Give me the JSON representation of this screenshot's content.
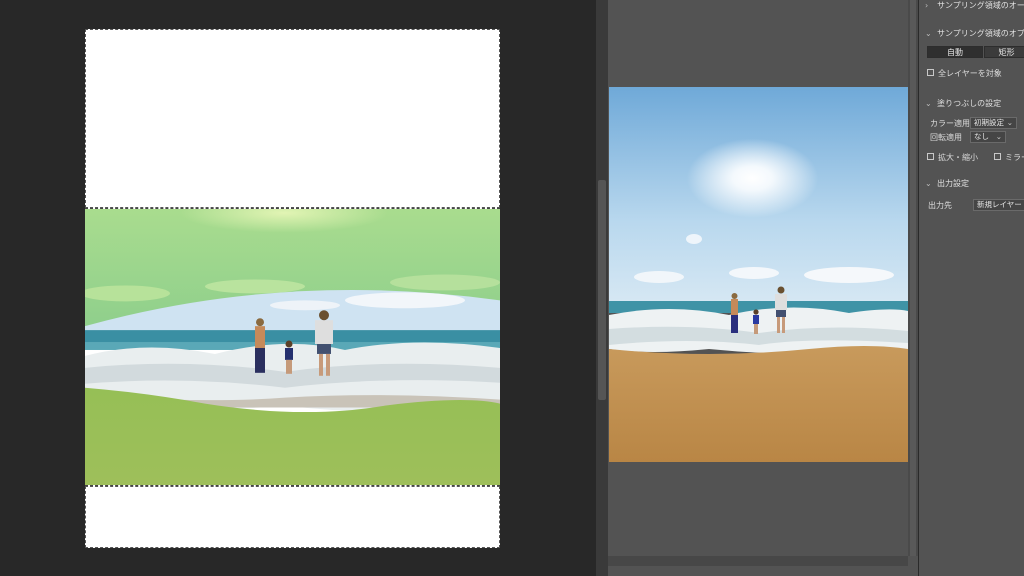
{
  "options": {
    "sampling_overlay": "サンプリング領域のオーバー",
    "sampling_options": "サンプリング領域のオプション",
    "mode_auto": "自動",
    "mode_rect": "矩形",
    "all_layers": "全レイヤーを対象",
    "fill_settings": "塗りつぶしの設定",
    "color_adapt_label": "カラー適用",
    "color_adapt_value": "初期設定",
    "rotate_adapt_label": "回転適用",
    "rotate_adapt_value": "なし",
    "scale_label": "拡大・縮小",
    "mirror_label": "ミラー",
    "output_settings": "出力設定",
    "output_to_label": "出力先",
    "output_to_value": "新規レイヤー"
  },
  "colors": {
    "workspace": "#282828",
    "preview_bg": "#535353",
    "panel_bg": "#535353",
    "overlay_green": "#9ad68a"
  }
}
